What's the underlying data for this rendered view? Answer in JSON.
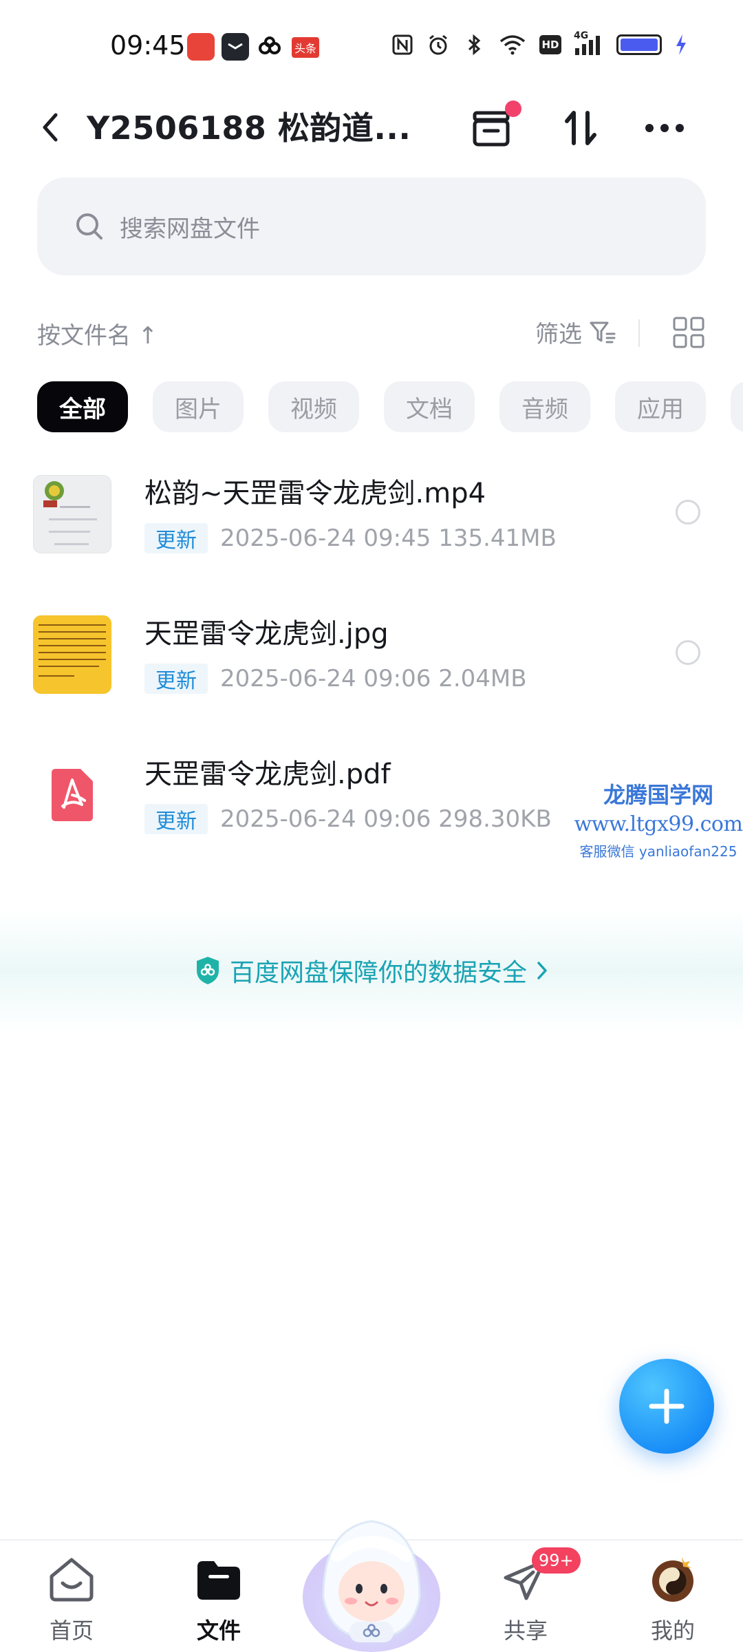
{
  "status_bar": {
    "time": "09:45",
    "app_icons": [
      "app-icon-red",
      "app-icon-dark",
      "baidu-netdisk-icon",
      "toutiao-icon"
    ],
    "toutiao_label": "头条",
    "right_icons": [
      "nfc-icon",
      "alarm-icon",
      "bluetooth-icon",
      "wifi-icon",
      "hd-icon",
      "signal-4g-icon",
      "battery-icon",
      "charging-icon"
    ],
    "hd_label": "HD",
    "network_label": "4G"
  },
  "header": {
    "title": "Y2506188 松韵道...",
    "has_notification_dot": true
  },
  "search": {
    "placeholder": "搜索网盘文件"
  },
  "sort": {
    "label": "按文件名 ↑",
    "filter_label": "筛选"
  },
  "chips": [
    "全部",
    "图片",
    "视频",
    "文档",
    "音频",
    "应用"
  ],
  "active_chip_index": 0,
  "files": [
    {
      "name": "松韵~天罡雷令龙虎剑.mp4",
      "badge": "更新",
      "meta": "2025-06-24  09:45   135.41MB",
      "type": "video"
    },
    {
      "name": "天罡雷令龙虎剑.jpg",
      "badge": "更新",
      "meta": "2025-06-24  09:06   2.04MB",
      "type": "image"
    },
    {
      "name": "天罡雷令龙虎剑.pdf",
      "badge": "更新",
      "meta": "2025-06-24  09:06   298.30KB",
      "type": "pdf"
    }
  ],
  "watermark": {
    "line1": "龙腾国学网",
    "line2": "www.ltgx99.com",
    "line3": "客服微信 yanliaofan225"
  },
  "security": {
    "text": "百度网盘保障你的数据安全",
    "color": "#19a3b3"
  },
  "bottom_nav": {
    "items": [
      {
        "label": "首页",
        "icon": "home-icon"
      },
      {
        "label": "文件",
        "icon": "folder-icon"
      },
      {
        "label": "共享",
        "icon": "share-plane-icon",
        "badge": "99+"
      },
      {
        "label": "我的",
        "icon": "avatar-icon"
      }
    ],
    "active_index": 1
  },
  "colors": {
    "accent": "#1a8ff7",
    "badge_red": "#f3415f",
    "chip_active": "#07070b"
  }
}
